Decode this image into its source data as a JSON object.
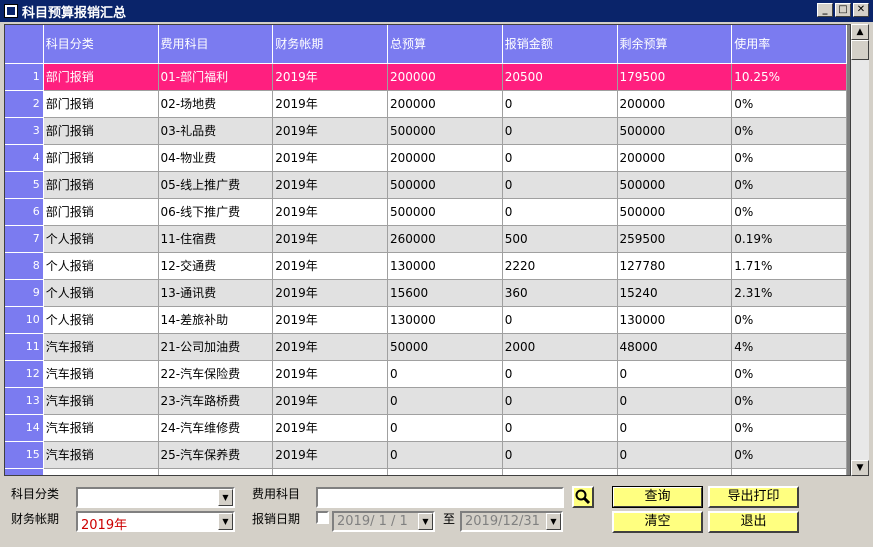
{
  "window": {
    "title": "科目预算报销汇总",
    "min_label": "_",
    "max_label": "□",
    "close_label": "✕"
  },
  "grid": {
    "columns": [
      "科目分类",
      "费用科目",
      "财务帐期",
      "总预算",
      "报销金额",
      "剩余预算",
      "使用率"
    ],
    "selected_row": 1,
    "rows": [
      {
        "n": "1",
        "cells": [
          "部门报销",
          "01-部门福利",
          "2019年",
          "200000",
          "20500",
          "179500",
          "10.25%"
        ]
      },
      {
        "n": "2",
        "cells": [
          "部门报销",
          "02-场地费",
          "2019年",
          "200000",
          "0",
          "200000",
          "0%"
        ]
      },
      {
        "n": "3",
        "cells": [
          "部门报销",
          "03-礼品费",
          "2019年",
          "500000",
          "0",
          "500000",
          "0%"
        ]
      },
      {
        "n": "4",
        "cells": [
          "部门报销",
          "04-物业费",
          "2019年",
          "200000",
          "0",
          "200000",
          "0%"
        ]
      },
      {
        "n": "5",
        "cells": [
          "部门报销",
          "05-线上推广费",
          "2019年",
          "500000",
          "0",
          "500000",
          "0%"
        ]
      },
      {
        "n": "6",
        "cells": [
          "部门报销",
          "06-线下推广费",
          "2019年",
          "500000",
          "0",
          "500000",
          "0%"
        ]
      },
      {
        "n": "7",
        "cells": [
          "个人报销",
          "11-住宿费",
          "2019年",
          "260000",
          "500",
          "259500",
          "0.19%"
        ]
      },
      {
        "n": "8",
        "cells": [
          "个人报销",
          "12-交通费",
          "2019年",
          "130000",
          "2220",
          "127780",
          "1.71%"
        ]
      },
      {
        "n": "9",
        "cells": [
          "个人报销",
          "13-通讯费",
          "2019年",
          "15600",
          "360",
          "15240",
          "2.31%"
        ]
      },
      {
        "n": "10",
        "cells": [
          "个人报销",
          "14-差旅补助",
          "2019年",
          "130000",
          "0",
          "130000",
          "0%"
        ]
      },
      {
        "n": "11",
        "cells": [
          "汽车报销",
          "21-公司加油费",
          "2019年",
          "50000",
          "2000",
          "48000",
          "4%"
        ]
      },
      {
        "n": "12",
        "cells": [
          "汽车报销",
          "22-汽车保险费",
          "2019年",
          "0",
          "0",
          "0",
          "0%"
        ]
      },
      {
        "n": "13",
        "cells": [
          "汽车报销",
          "23-汽车路桥费",
          "2019年",
          "0",
          "0",
          "0",
          "0%"
        ]
      },
      {
        "n": "14",
        "cells": [
          "汽车报销",
          "24-汽车维修费",
          "2019年",
          "0",
          "0",
          "0",
          "0%"
        ]
      },
      {
        "n": "15",
        "cells": [
          "汽车报销",
          "25-汽车保养费",
          "2019年",
          "0",
          "0",
          "0",
          "0%"
        ]
      }
    ]
  },
  "filters": {
    "category_label": "科目分类",
    "category_value": "",
    "period_label": "财务帐期",
    "period_value": "2019年",
    "expense_label": "费用科目",
    "expense_value": "",
    "date_label": "报销日期",
    "date_from": "2019/ 1 / 1",
    "date_to_label": "至",
    "date_to": "2019/12/31"
  },
  "buttons": {
    "query": "查询",
    "export_print": "导出打印",
    "clear": "清空",
    "exit": "退出"
  },
  "colors": {
    "header_bg": "#7b7bf0",
    "selected_row_bg": "#ff1f7f",
    "button_bg": "#ffff80",
    "period_text": "#cc0000"
  }
}
